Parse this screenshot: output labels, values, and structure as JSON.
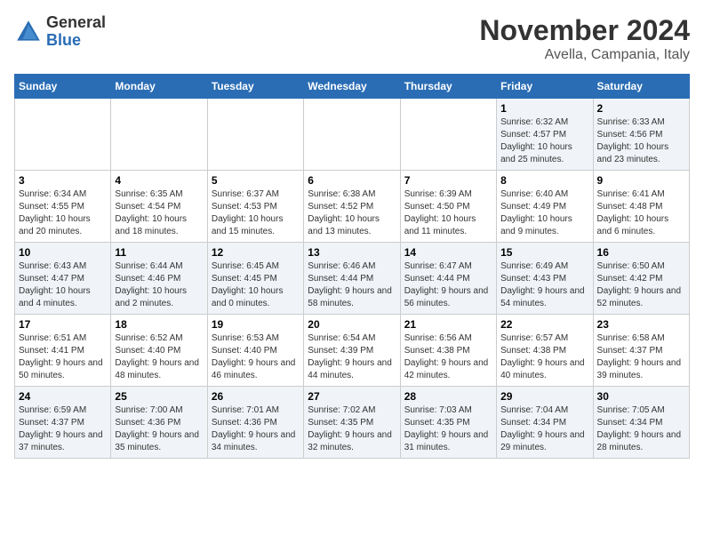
{
  "logo": {
    "general": "General",
    "blue": "Blue"
  },
  "header": {
    "month": "November 2024",
    "location": "Avella, Campania, Italy"
  },
  "weekdays": [
    "Sunday",
    "Monday",
    "Tuesday",
    "Wednesday",
    "Thursday",
    "Friday",
    "Saturday"
  ],
  "weeks": [
    [
      {
        "day": "",
        "info": ""
      },
      {
        "day": "",
        "info": ""
      },
      {
        "day": "",
        "info": ""
      },
      {
        "day": "",
        "info": ""
      },
      {
        "day": "",
        "info": ""
      },
      {
        "day": "1",
        "info": "Sunrise: 6:32 AM\nSunset: 4:57 PM\nDaylight: 10 hours and 25 minutes."
      },
      {
        "day": "2",
        "info": "Sunrise: 6:33 AM\nSunset: 4:56 PM\nDaylight: 10 hours and 23 minutes."
      }
    ],
    [
      {
        "day": "3",
        "info": "Sunrise: 6:34 AM\nSunset: 4:55 PM\nDaylight: 10 hours and 20 minutes."
      },
      {
        "day": "4",
        "info": "Sunrise: 6:35 AM\nSunset: 4:54 PM\nDaylight: 10 hours and 18 minutes."
      },
      {
        "day": "5",
        "info": "Sunrise: 6:37 AM\nSunset: 4:53 PM\nDaylight: 10 hours and 15 minutes."
      },
      {
        "day": "6",
        "info": "Sunrise: 6:38 AM\nSunset: 4:52 PM\nDaylight: 10 hours and 13 minutes."
      },
      {
        "day": "7",
        "info": "Sunrise: 6:39 AM\nSunset: 4:50 PM\nDaylight: 10 hours and 11 minutes."
      },
      {
        "day": "8",
        "info": "Sunrise: 6:40 AM\nSunset: 4:49 PM\nDaylight: 10 hours and 9 minutes."
      },
      {
        "day": "9",
        "info": "Sunrise: 6:41 AM\nSunset: 4:48 PM\nDaylight: 10 hours and 6 minutes."
      }
    ],
    [
      {
        "day": "10",
        "info": "Sunrise: 6:43 AM\nSunset: 4:47 PM\nDaylight: 10 hours and 4 minutes."
      },
      {
        "day": "11",
        "info": "Sunrise: 6:44 AM\nSunset: 4:46 PM\nDaylight: 10 hours and 2 minutes."
      },
      {
        "day": "12",
        "info": "Sunrise: 6:45 AM\nSunset: 4:45 PM\nDaylight: 10 hours and 0 minutes."
      },
      {
        "day": "13",
        "info": "Sunrise: 6:46 AM\nSunset: 4:44 PM\nDaylight: 9 hours and 58 minutes."
      },
      {
        "day": "14",
        "info": "Sunrise: 6:47 AM\nSunset: 4:44 PM\nDaylight: 9 hours and 56 minutes."
      },
      {
        "day": "15",
        "info": "Sunrise: 6:49 AM\nSunset: 4:43 PM\nDaylight: 9 hours and 54 minutes."
      },
      {
        "day": "16",
        "info": "Sunrise: 6:50 AM\nSunset: 4:42 PM\nDaylight: 9 hours and 52 minutes."
      }
    ],
    [
      {
        "day": "17",
        "info": "Sunrise: 6:51 AM\nSunset: 4:41 PM\nDaylight: 9 hours and 50 minutes."
      },
      {
        "day": "18",
        "info": "Sunrise: 6:52 AM\nSunset: 4:40 PM\nDaylight: 9 hours and 48 minutes."
      },
      {
        "day": "19",
        "info": "Sunrise: 6:53 AM\nSunset: 4:40 PM\nDaylight: 9 hours and 46 minutes."
      },
      {
        "day": "20",
        "info": "Sunrise: 6:54 AM\nSunset: 4:39 PM\nDaylight: 9 hours and 44 minutes."
      },
      {
        "day": "21",
        "info": "Sunrise: 6:56 AM\nSunset: 4:38 PM\nDaylight: 9 hours and 42 minutes."
      },
      {
        "day": "22",
        "info": "Sunrise: 6:57 AM\nSunset: 4:38 PM\nDaylight: 9 hours and 40 minutes."
      },
      {
        "day": "23",
        "info": "Sunrise: 6:58 AM\nSunset: 4:37 PM\nDaylight: 9 hours and 39 minutes."
      }
    ],
    [
      {
        "day": "24",
        "info": "Sunrise: 6:59 AM\nSunset: 4:37 PM\nDaylight: 9 hours and 37 minutes."
      },
      {
        "day": "25",
        "info": "Sunrise: 7:00 AM\nSunset: 4:36 PM\nDaylight: 9 hours and 35 minutes."
      },
      {
        "day": "26",
        "info": "Sunrise: 7:01 AM\nSunset: 4:36 PM\nDaylight: 9 hours and 34 minutes."
      },
      {
        "day": "27",
        "info": "Sunrise: 7:02 AM\nSunset: 4:35 PM\nDaylight: 9 hours and 32 minutes."
      },
      {
        "day": "28",
        "info": "Sunrise: 7:03 AM\nSunset: 4:35 PM\nDaylight: 9 hours and 31 minutes."
      },
      {
        "day": "29",
        "info": "Sunrise: 7:04 AM\nSunset: 4:34 PM\nDaylight: 9 hours and 29 minutes."
      },
      {
        "day": "30",
        "info": "Sunrise: 7:05 AM\nSunset: 4:34 PM\nDaylight: 9 hours and 28 minutes."
      }
    ]
  ]
}
